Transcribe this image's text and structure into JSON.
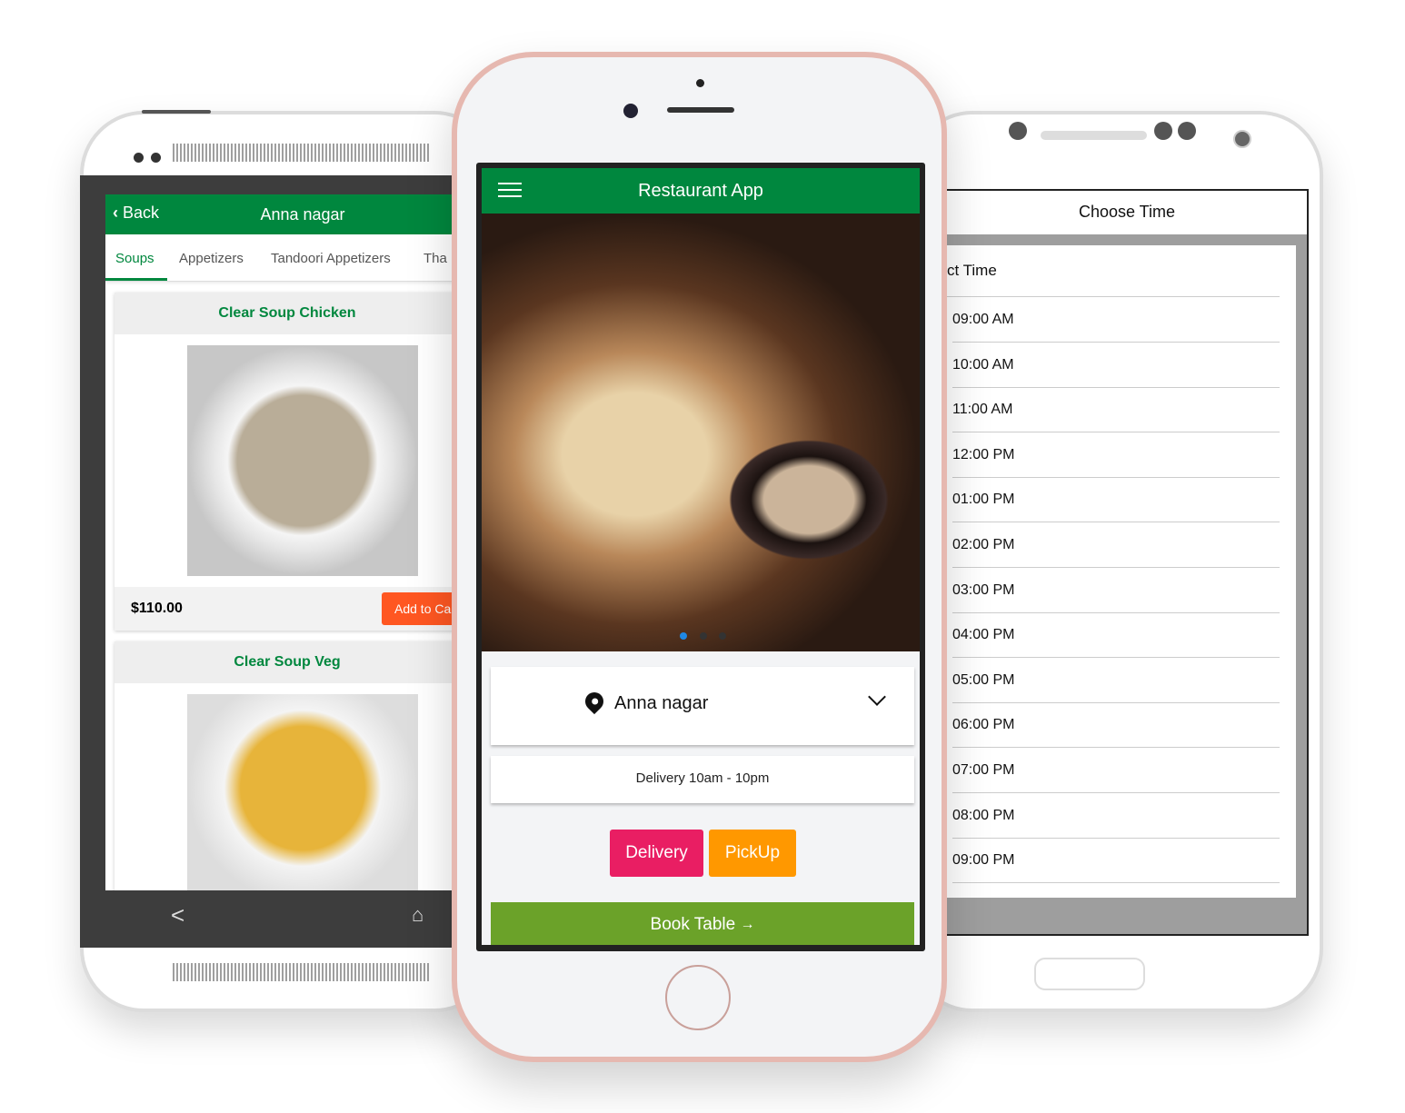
{
  "colors": {
    "brand_green": "#00873e",
    "delivery": "#e91e63",
    "pickup": "#ff9800",
    "book": "#6ba229",
    "tab_active": "#00873e"
  },
  "left": {
    "back_label": "Back",
    "title": "Anna nagar",
    "tabs": [
      "Soups",
      "Appetizers",
      "Tandoori Appetizers",
      "Tha"
    ],
    "items": [
      {
        "name": "Clear Soup Chicken",
        "price": "$110.00",
        "add_label": "Add to Ca"
      },
      {
        "name": "Clear Soup Veg"
      }
    ]
  },
  "center": {
    "title": "Restaurant App",
    "location": "Anna nagar",
    "hours": "Delivery 10am - 10pm",
    "delivery_label": "Delivery",
    "pickup_label": "PickUp",
    "book_label": "Book Table",
    "book_arrow": "→",
    "carousel_active": 1,
    "carousel_count": 3
  },
  "right": {
    "header": "Choose Time",
    "subtitle": "ct Time",
    "times": [
      "09:00 AM",
      "10:00 AM",
      "11:00 AM",
      "12:00 PM",
      "01:00 PM",
      "02:00 PM",
      "03:00 PM",
      "04:00 PM",
      "05:00 PM",
      "06:00 PM",
      "07:00 PM",
      "08:00 PM",
      "09:00 PM"
    ]
  }
}
